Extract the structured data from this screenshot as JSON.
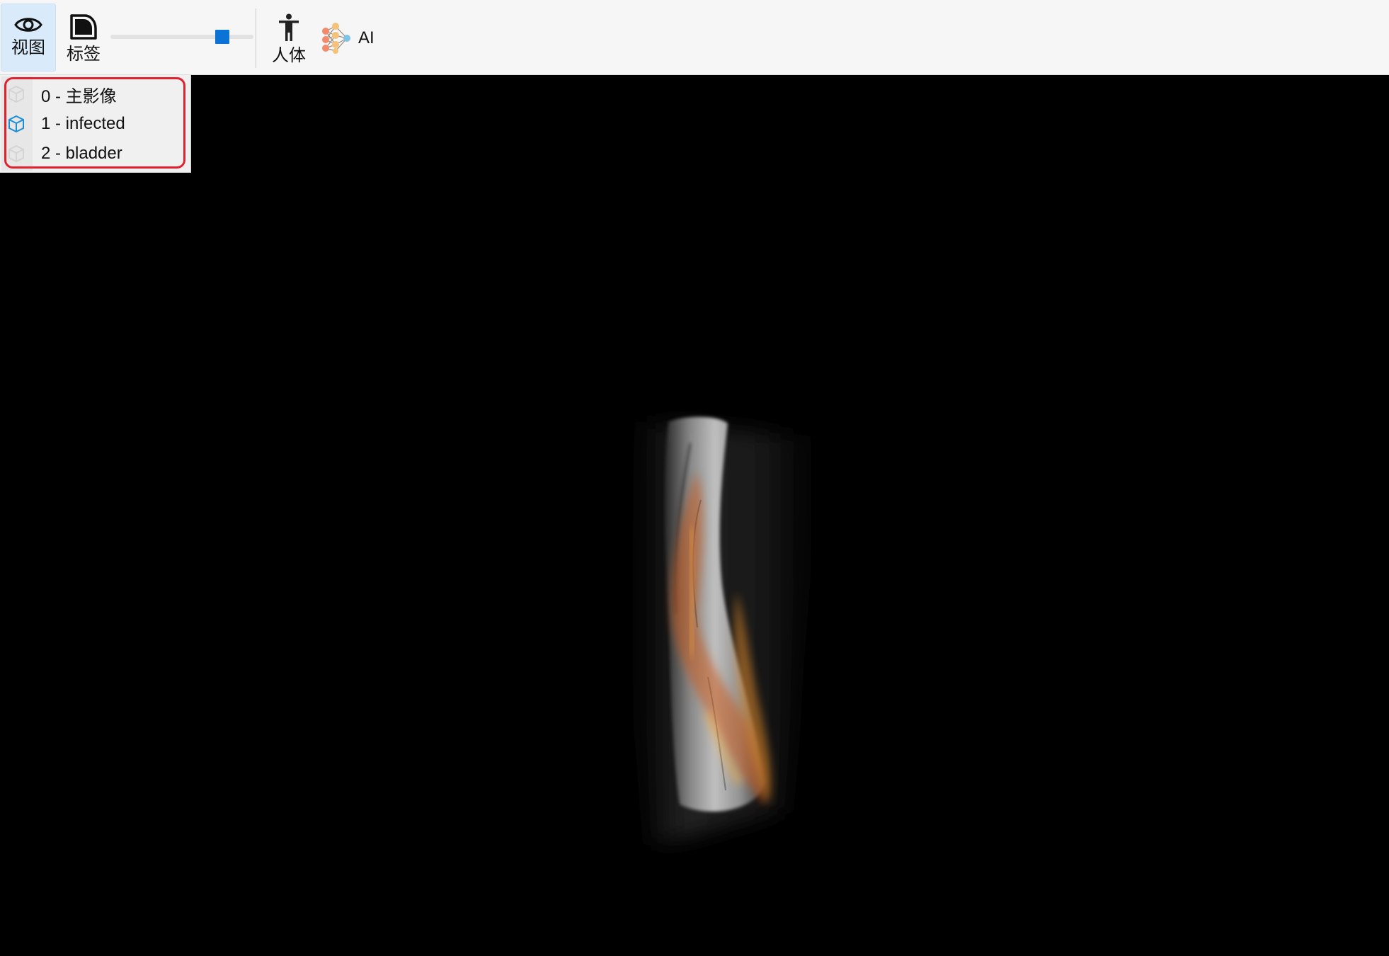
{
  "toolbar": {
    "view_label": "视图",
    "label_label": "标签",
    "body_label": "人体",
    "ai_label": "AI",
    "opacity_fraction": 0.78,
    "accent_color": "#0b72d6"
  },
  "layers": [
    {
      "label": "0 - 主影像",
      "icon": "cube-icon",
      "selected": false
    },
    {
      "label": "1 - infected",
      "icon": "cube-icon",
      "selected": true
    },
    {
      "label": "2 - bladder",
      "icon": "cube-icon",
      "selected": false
    }
  ],
  "colors": {
    "layer_selected_icon": "#1a8fd6",
    "layer_unselected_icon": "#d4d4d4",
    "highlight_outline": "#e0212e"
  }
}
